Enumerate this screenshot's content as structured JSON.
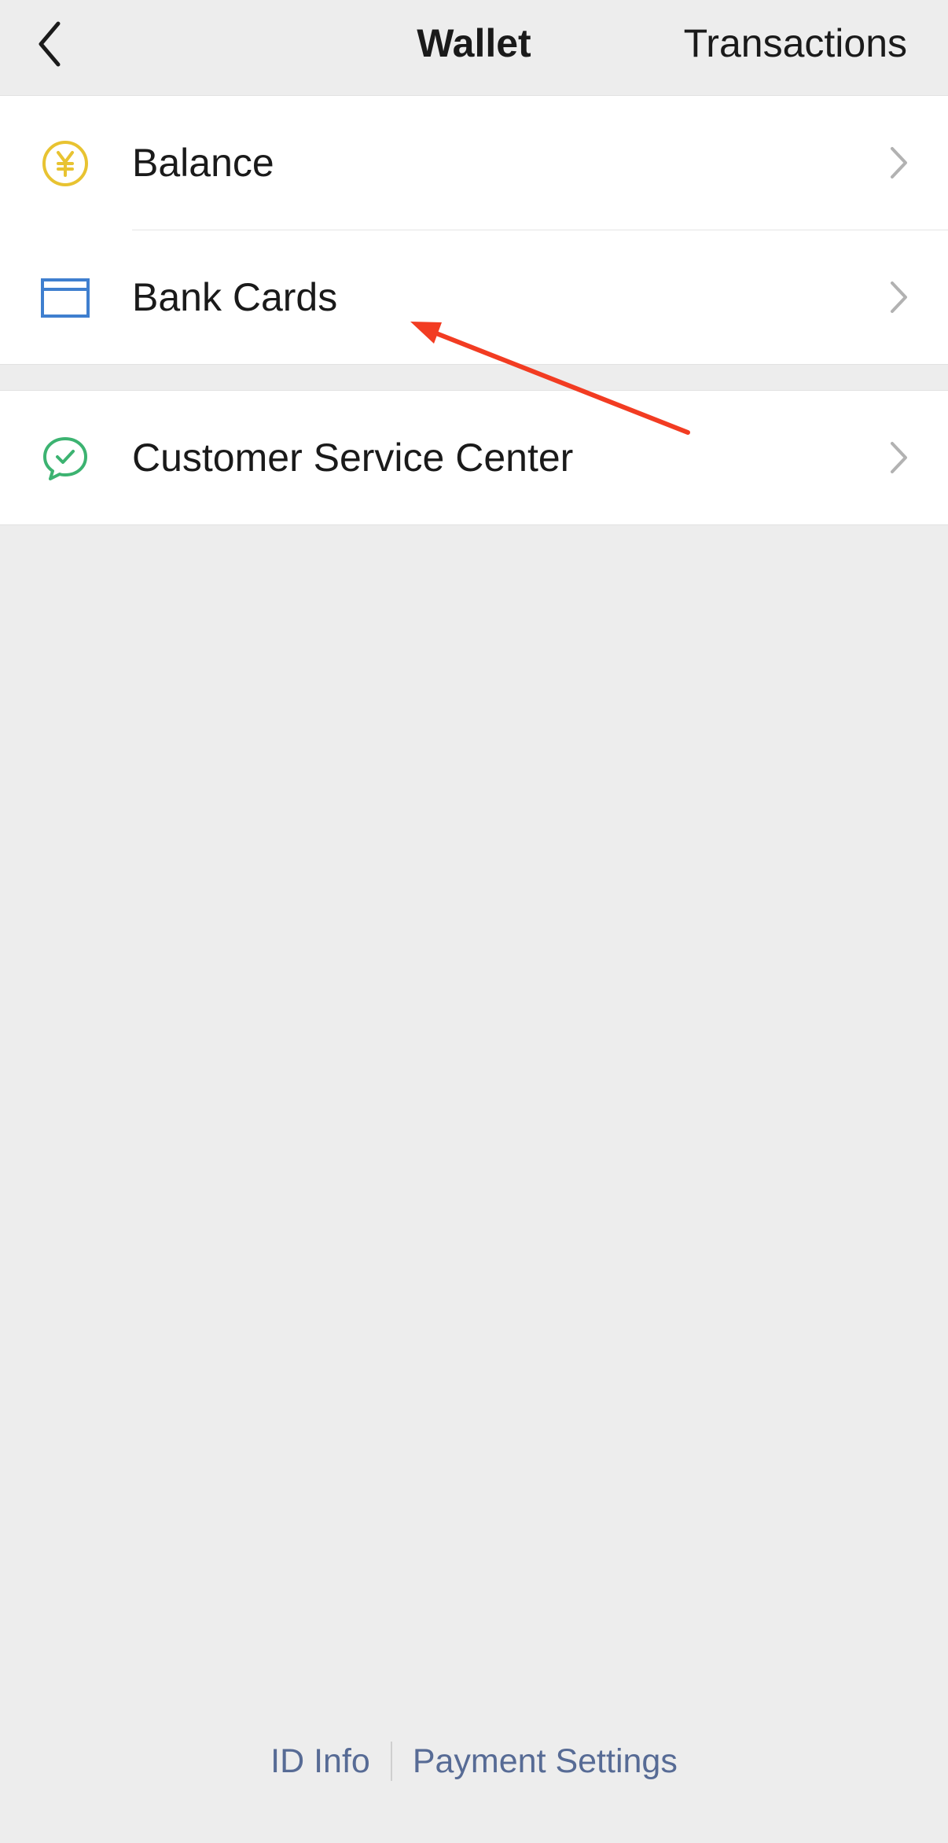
{
  "navbar": {
    "back_icon": "chevron-left-icon",
    "title": "Wallet",
    "right_action": "Transactions"
  },
  "menu": {
    "group1": [
      {
        "label": "Balance",
        "icon": "yuan-coin-icon",
        "icon_color": "#e8c331"
      },
      {
        "label": "Bank Cards",
        "icon": "bank-card-icon",
        "icon_color": "#3f7fcf"
      }
    ],
    "group2": [
      {
        "label": "Customer Service Center",
        "icon": "chat-check-icon",
        "icon_color": "#3cb371"
      }
    ]
  },
  "annotation": {
    "color": "#f23c22"
  },
  "footer": {
    "links": [
      "ID Info",
      "Payment Settings"
    ],
    "link_color": "#576b95"
  }
}
